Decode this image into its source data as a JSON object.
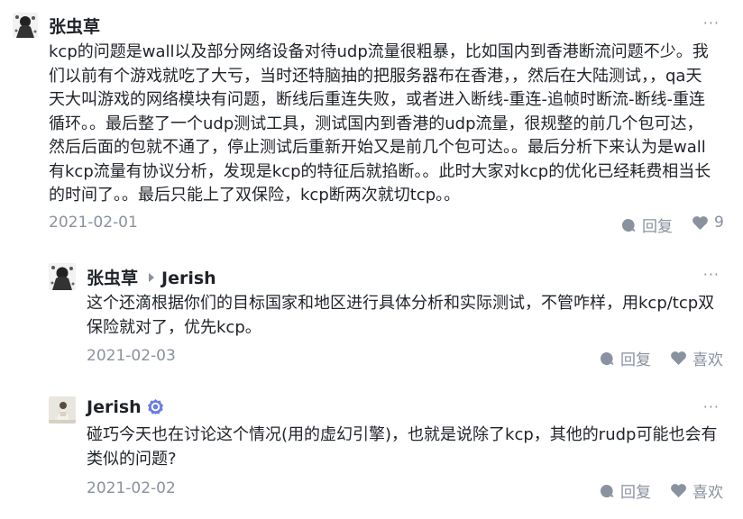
{
  "comments": [
    {
      "author": "张虫草",
      "body": "kcp的问题是wall以及部分网络设备对待udp流量很粗暴，比如国内到香港断流问题不少。我们以前有个游戏就吃了大亏，当时还特脑抽的把服务器布在香港，，然后在大陆测试，，qa天天大叫游戏的网络模块有问题，断线后重连失败，或者进入断线-重连-追帧时断流-断线-重连循环。。最后整了一个udp测试工具，测试国内到香港的udp流量，很规整的前几个包可达，然后后面的包就不通了，停止测试后重新开始又是前几个包可达。。最后分析下来认为是wall有kcp流量有协议分析，发现是kcp的特征后就掐断。。此时大家对kcp的优化已经耗费相当长的时间了。。最后只能上了双保险，kcp断两次就切tcp。。",
      "date": "2021-02-01",
      "reply_label": "回复",
      "like_label": "9"
    },
    {
      "author": "张虫草",
      "reply_to": "Jerish",
      "body": "这个还滴根据你们的目标国家和地区进行具体分析和实际测试，不管咋样，用kcp/tcp双保险就对了，优先kcp。",
      "date": "2021-02-03",
      "reply_label": "回复",
      "like_label": "喜欢"
    },
    {
      "author": "Jerish",
      "verified": true,
      "body": "碰巧今天也在讨论这个情况(用的虚幻引擎)，也就是说除了kcp，其他的rudp可能也会有类似的问题?",
      "date": "2021-02-02",
      "reply_label": "回复",
      "like_label": "喜欢"
    }
  ],
  "more_label": "···",
  "icons": {
    "reply": "comment-bubble-icon",
    "like": "heart-icon",
    "more": "more-dots-icon",
    "verified": "verified-badge-icon"
  },
  "colors": {
    "text": "#1f2329",
    "muted": "#8a919f",
    "verified": "#6b7fe0"
  }
}
